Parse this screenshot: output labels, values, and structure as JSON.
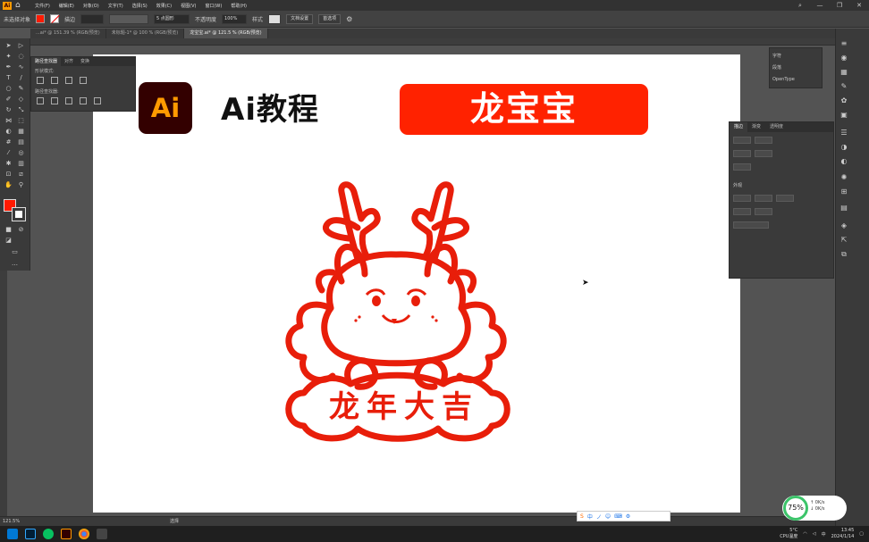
{
  "app": {
    "logo": "Ai"
  },
  "menubar": {
    "items": [
      "文件(F)",
      "编辑(E)",
      "对象(O)",
      "文字(T)",
      "选择(S)",
      "效果(C)",
      "视图(V)",
      "窗口(W)",
      "帮助(H)"
    ]
  },
  "controlbar": {
    "selection_label": "未选择对象",
    "stroke_label": "描边",
    "point_label": "5 点圆形",
    "opacity_label": "不透明度",
    "opacity_value": "100%",
    "style_label": "样式",
    "doc_setup_button": "文档设置",
    "prefs_button": "首选项"
  },
  "tabs": [
    {
      "label": "...ai* @ 151.39 % (RGB/预览)",
      "active": false
    },
    {
      "label": "未标题-1* @ 100 % (RGB/预览)",
      "active": false
    },
    {
      "label": "龙宝宝.ai* @ 121.5 % (RGB/预览)",
      "active": true
    }
  ],
  "float_panel": {
    "tabs": [
      "路径查找器",
      "对齐",
      "变换"
    ],
    "shape_modes_label": "形状模式:",
    "pathfinder_label": "路径查找器:"
  },
  "canvas": {
    "logo_text": "Ai",
    "title": "Ai教程",
    "banner": "龙宝宝",
    "caption": "龙年大吉"
  },
  "right_mini_panel": {
    "items": [
      "字符",
      "段落",
      "OpenType"
    ]
  },
  "prop_panel": {
    "tabs": [
      "描边",
      "渐变",
      "透明度"
    ],
    "appearance_label": "外观"
  },
  "statusbar": {
    "zoom": "121.5%",
    "tool": "选择"
  },
  "ime": {
    "items": [
      "中",
      "ノ",
      "☺",
      "⌨",
      "⚙"
    ]
  },
  "perf": {
    "percent": "75%",
    "up": "↑ 0K/s",
    "down": "↓ 0K/s"
  },
  "tray": {
    "weather": "5°C",
    "cpu": "CPU温度",
    "time": "13:45",
    "date": "2024/1/14"
  },
  "colors": {
    "accent_red": "#ff2200",
    "dragon_red": "#e81e0a",
    "ai_brown": "#330000",
    "ai_orange": "#ff9a00"
  }
}
